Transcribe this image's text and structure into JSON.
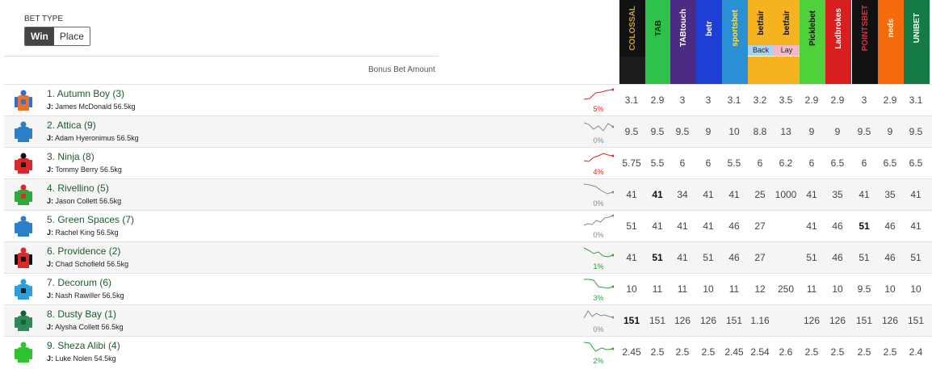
{
  "bet_type": {
    "label": "BET TYPE",
    "options": [
      "Win",
      "Place"
    ],
    "selected": "Win"
  },
  "bonus_label": "Bonus Bet Amount",
  "bookmakers": [
    {
      "name": "COLOSSAL",
      "bg": "#111111",
      "fg": "#c9a227",
      "strip": "#1c1c1c"
    },
    {
      "name": "TAB",
      "bg": "#2ec24c",
      "fg": "#0b2a12",
      "strip": "#2ec24c"
    },
    {
      "name": "TABtouch",
      "bg": "#4b2b83",
      "fg": "#ffffff",
      "strip": "#4b2b83"
    },
    {
      "name": "betr",
      "bg": "#1d3fd6",
      "fg": "#ffffff",
      "strip": "#1d3fd6"
    },
    {
      "name": "sportsbet",
      "bg": "#2b8fd6",
      "fg": "#ffe14a",
      "strip": "#2b8fd6"
    },
    {
      "name": "betfair",
      "bg": "#f7b21f",
      "fg": "#111111",
      "strip": "#f7b21f",
      "sub": "Back",
      "sub_bg": "#a7d4f2"
    },
    {
      "name": "betfair",
      "bg": "#f7b21f",
      "fg": "#111111",
      "strip": "#f7b21f",
      "sub": "Lay",
      "sub_bg": "#f6b8c6"
    },
    {
      "name": "Picklebet",
      "bg": "#4fd13b",
      "fg": "#111111",
      "strip": "#4fd13b"
    },
    {
      "name": "Ladbrokes",
      "bg": "#d81e1e",
      "fg": "#ffffff",
      "strip": "#d81e1e"
    },
    {
      "name": "POINTSBET",
      "bg": "#111111",
      "fg": "#e8283a",
      "strip": "#111111"
    },
    {
      "name": "neds",
      "bg": "#f46b0e",
      "fg": "#ffffff",
      "strip": "#f46b0e"
    },
    {
      "name": "UNIBET",
      "bg": "#147b45",
      "fg": "#ffffff",
      "strip": "#147b45"
    }
  ],
  "runners": [
    {
      "name": "1. Autumn Boy (3)",
      "jockey_prefix": "J:",
      "jockey": "James McDonald 56.5kg",
      "pct": "5%",
      "trend": "up",
      "silk": {
        "body": "#e8732a",
        "pattern": "#2e6fd1",
        "cap": "#2e6fd1",
        "arms": "#2e6fd1"
      },
      "spark": [
        14,
        13,
        6,
        5,
        3,
        2
      ],
      "odds": [
        "3.1",
        "2.9",
        "3",
        "3",
        "3.1",
        "3.2",
        "3.5",
        "2.9",
        "2.9",
        "3",
        "2.9",
        "3.1"
      ],
      "best": []
    },
    {
      "name": "2. Attica (9)",
      "jockey_prefix": "J:",
      "jockey": "Adam Hyeronimus 56.5kg",
      "pct": "0%",
      "trend": "neutral",
      "silk": {
        "body": "#2b7fc4",
        "pattern": "#2b7fc4",
        "cap": "#2b7fc4",
        "arms": "#2b7fc4"
      },
      "spark": [
        4,
        6,
        12,
        8,
        14,
        5,
        9
      ],
      "odds": [
        "9.5",
        "9.5",
        "9.5",
        "9",
        "10",
        "8.8",
        "13",
        "9",
        "9",
        "9.5",
        "9",
        "9.5"
      ],
      "best": []
    },
    {
      "name": "3. Ninja (8)",
      "jockey_prefix": "J:",
      "jockey": "Tommy Berry 56.5kg",
      "pct": "4%",
      "trend": "up",
      "silk": {
        "body": "#d82a2a",
        "pattern": "#111111",
        "cap": "#111111",
        "arms": "#d82a2a"
      },
      "spark": [
        12,
        13,
        8,
        6,
        3,
        5,
        6
      ],
      "odds": [
        "5.75",
        "5.5",
        "6",
        "6",
        "5.5",
        "6",
        "6.2",
        "6",
        "6.5",
        "6",
        "6.5",
        "6.5"
      ],
      "best": []
    },
    {
      "name": "4. Rivellino (5)",
      "jockey_prefix": "J:",
      "jockey": "Jason Collett 56.5kg",
      "pct": "0%",
      "trend": "neutral",
      "silk": {
        "body": "#2fa83a",
        "pattern": "#d82a2a",
        "cap": "#d82a2a",
        "arms": "#2fa83a"
      },
      "spark": [
        2,
        3,
        5,
        10,
        14,
        12
      ],
      "odds": [
        "41",
        "41",
        "34",
        "41",
        "41",
        "25",
        "1000",
        "41",
        "35",
        "41",
        "35",
        "41"
      ],
      "best": [
        1
      ]
    },
    {
      "name": "5. Green Spaces (7)",
      "jockey_prefix": "J:",
      "jockey": "Rachel King 56.5kg",
      "pct": "0%",
      "trend": "neutral",
      "silk": {
        "body": "#2b7fc4",
        "pattern": "#2b7fc4",
        "cap": "#2b7fc4",
        "arms": "#2b7fc4"
      },
      "spark": [
        14,
        12,
        13,
        8,
        10,
        5,
        4,
        2
      ],
      "odds": [
        "51",
        "41",
        "41",
        "41",
        "46",
        "27",
        "",
        "41",
        "46",
        "51",
        "46",
        "41"
      ],
      "best": [
        9
      ]
    },
    {
      "name": "6. Providence (2)",
      "jockey_prefix": "J:",
      "jockey": "Chad Schofield 56.5kg",
      "pct": "1%",
      "trend": "down",
      "silk": {
        "body": "#d82a2a",
        "pattern": "#111111",
        "cap": "#d82a2a",
        "arms": "#111111"
      },
      "spark": [
        3,
        6,
        10,
        8,
        13,
        14,
        12
      ],
      "odds": [
        "41",
        "51",
        "41",
        "51",
        "46",
        "27",
        "",
        "51",
        "46",
        "51",
        "46",
        "51"
      ],
      "best": [
        1
      ]
    },
    {
      "name": "7. Decorum (6)",
      "jockey_prefix": "J:",
      "jockey": "Nash Rawiller 56.5kg",
      "pct": "3%",
      "trend": "down",
      "silk": {
        "body": "#2b9fdc",
        "pattern": "#111111",
        "cap": "#2b9fdc",
        "arms": "#2b9fdc"
      },
      "spark": [
        3,
        3,
        4,
        12,
        13,
        14,
        12
      ],
      "odds": [
        "10",
        "11",
        "11",
        "10",
        "11",
        "12",
        "250",
        "11",
        "10",
        "9.5",
        "10",
        "10"
      ],
      "best": []
    },
    {
      "name": "8. Dusty Bay (1)",
      "jockey_prefix": "J:",
      "jockey": "Alysha Collett 56.5kg",
      "pct": "0%",
      "trend": "neutral",
      "silk": {
        "body": "#2e8b57",
        "pattern": "#1b5a36",
        "cap": "#1b5a36",
        "arms": "#2e8b57"
      },
      "spark": [
        12,
        3,
        10,
        6,
        9,
        8,
        10,
        11
      ],
      "odds": [
        "151",
        "151",
        "126",
        "126",
        "151",
        "1.16",
        "",
        "126",
        "126",
        "151",
        "126",
        "151"
      ],
      "best": [
        0
      ]
    },
    {
      "name": "9. Sheza Alibi (4)",
      "jockey_prefix": "J:",
      "jockey": "Luke Nolen 54.5kg",
      "pct": "2%",
      "trend": "down",
      "silk": {
        "body": "#2fc42f",
        "pattern": "#2fc42f",
        "cap": "#2fc42f",
        "arms": "#2fc42f"
      },
      "spark": [
        3,
        4,
        14,
        10,
        12,
        11
      ],
      "odds": [
        "2.45",
        "2.5",
        "2.5",
        "2.5",
        "2.45",
        "2.54",
        "2.6",
        "2.5",
        "2.5",
        "2.5",
        "2.5",
        "2.4"
      ],
      "best": []
    }
  ]
}
